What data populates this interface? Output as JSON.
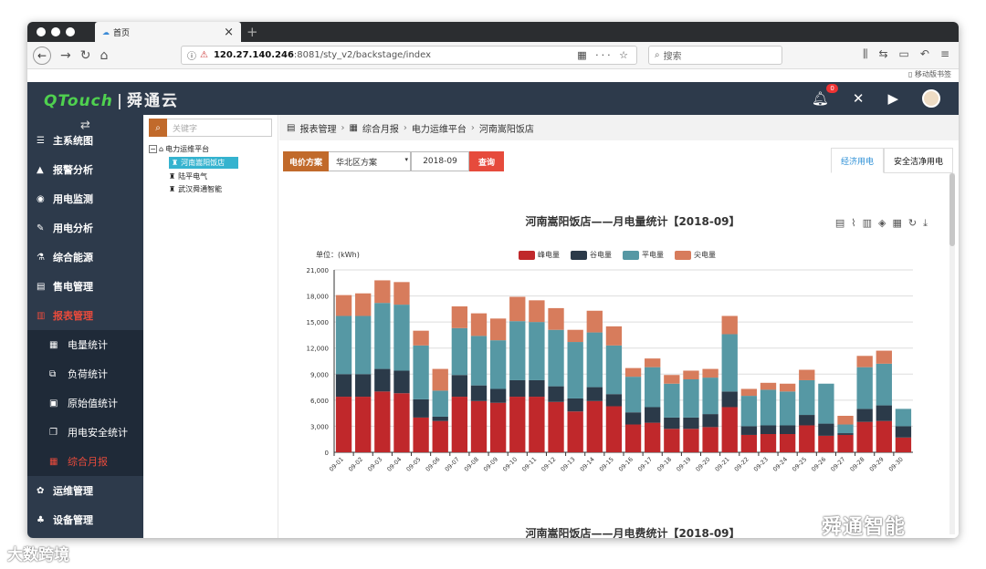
{
  "browser": {
    "tab_title": "首页",
    "url_host": "120.27.140.246",
    "url_path": ":8081/sty_v2/backstage/index",
    "search_placeholder": "搜索",
    "mobile_bookmarks": "移动版书签"
  },
  "header": {
    "logo_en": "QTouch",
    "logo_sep": "|",
    "logo_cn": "舜通云",
    "notification_count": "0"
  },
  "sidebar": {
    "items": [
      {
        "label": "主系统图",
        "icon": "grid-icon"
      },
      {
        "label": "报警分析",
        "icon": "bell-icon"
      },
      {
        "label": "用电监测",
        "icon": "eye-icon"
      },
      {
        "label": "用电分析",
        "icon": "pencil-icon"
      },
      {
        "label": "综合能源",
        "icon": "flask-icon"
      },
      {
        "label": "售电管理",
        "icon": "doc-icon"
      },
      {
        "label": "报表管理",
        "icon": "report-icon"
      }
    ],
    "sub_items": [
      {
        "label": "电量统计"
      },
      {
        "label": "负荷统计"
      },
      {
        "label": "原始值统计"
      },
      {
        "label": "用电安全统计"
      },
      {
        "label": "综合月报"
      }
    ],
    "bottom_items": [
      {
        "label": "运维管理"
      },
      {
        "label": "设备管理"
      }
    ]
  },
  "tree": {
    "search_placeholder": "关键字",
    "root": "电力运维平台",
    "nodes": [
      "河南嵩阳饭店",
      "陆平电气",
      "武汉舜通智能"
    ]
  },
  "breadcrumb": [
    "报表管理",
    "综合月报",
    "电力运维平台",
    "河南嵩阳饭店"
  ],
  "filters": {
    "price_label": "电价方案",
    "price_value": "华北区方案",
    "date": "2018-09",
    "query_button": "查询"
  },
  "tabs": [
    "经济用电",
    "安全洁净用电"
  ],
  "chart_data": {
    "type": "bar",
    "stacked": true,
    "title": "河南嵩阳饭店——月电量统计【2018-09】",
    "unit_label": "单位：(kWh)",
    "ylim": [
      0,
      21000
    ],
    "yticks": [
      "0",
      "3,000",
      "6,000",
      "9,000",
      "12,000",
      "15,000",
      "18,000",
      "21,000"
    ],
    "categories": [
      "09-01",
      "09-02",
      "09-03",
      "09-04",
      "09-05",
      "09-06",
      "09-07",
      "09-08",
      "09-09",
      "09-10",
      "09-11",
      "09-12",
      "09-13",
      "09-14",
      "09-15",
      "09-16",
      "09-17",
      "09-18",
      "09-19",
      "09-20",
      "09-21",
      "09-22",
      "09-23",
      "09-24",
      "09-25",
      "09-26",
      "09-27",
      "09-28",
      "09-29",
      "09-30"
    ],
    "series": [
      {
        "name": "峰电量",
        "color": "#c0282b",
        "values": [
          6400,
          6400,
          7000,
          6800,
          4000,
          3600,
          6400,
          5900,
          5700,
          6400,
          6400,
          5800,
          4700,
          5900,
          5300,
          3200,
          3400,
          2700,
          2700,
          2900,
          5200,
          2000,
          2100,
          2100,
          3100,
          1900,
          2000,
          3500,
          3600,
          1700
        ]
      },
      {
        "name": "谷电量",
        "color": "#2b3a49",
        "values": [
          2600,
          2600,
          2600,
          2600,
          2100,
          500,
          2500,
          1800,
          1600,
          1900,
          1900,
          1800,
          1500,
          1600,
          1400,
          1400,
          1800,
          1300,
          1300,
          1500,
          1800,
          1000,
          1000,
          1000,
          1200,
          1400,
          200,
          1500,
          1800,
          1300
        ]
      },
      {
        "name": "平电量",
        "color": "#5698a4",
        "values": [
          6700,
          6700,
          7600,
          7600,
          6200,
          3000,
          5400,
          5700,
          5600,
          6800,
          6700,
          6500,
          6500,
          6300,
          5600,
          4100,
          4600,
          3900,
          4400,
          4200,
          6600,
          3500,
          4100,
          3900,
          4000,
          4600,
          1000,
          4800,
          4800,
          2000
        ]
      },
      {
        "name": "尖电量",
        "color": "#d77c5c",
        "values": [
          2400,
          2600,
          2600,
          2600,
          1700,
          2500,
          2500,
          2600,
          2500,
          2800,
          2500,
          2500,
          1400,
          2500,
          2200,
          1000,
          1000,
          1000,
          1000,
          1000,
          2100,
          800,
          800,
          900,
          1200,
          0,
          1000,
          1300,
          1500,
          0
        ]
      }
    ]
  },
  "chart2_title": "河南嵩阳饭店——月电费统计【2018-09】",
  "watermark": {
    "brand": "舜通智能",
    "source": "大数跨境"
  }
}
